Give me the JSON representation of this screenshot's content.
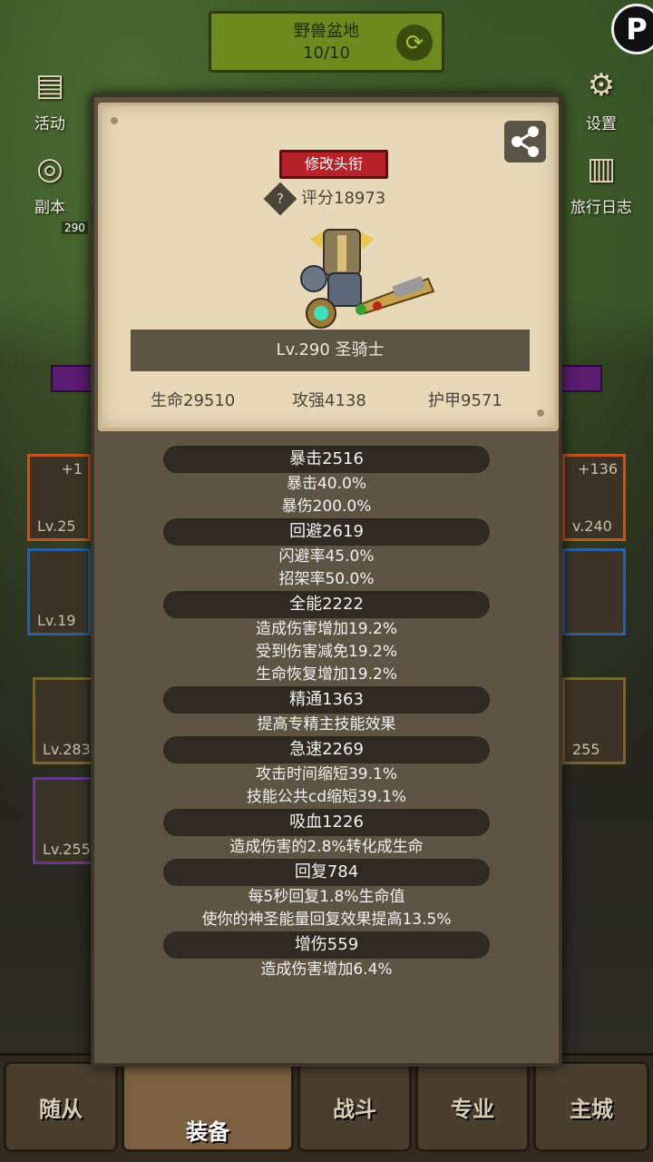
{
  "background": {
    "location_name": "野兽盆地",
    "location_progress": "10/10",
    "left_menu": [
      {
        "label": "活动",
        "icon": "event-scroll-icon"
      },
      {
        "label": "副本",
        "icon": "dungeon-portal-icon"
      }
    ],
    "right_menu": [
      {
        "label": "设置",
        "icon": "gear-icon"
      },
      {
        "label": "旅行日志",
        "icon": "journal-icon"
      }
    ],
    "side_small_level": "290",
    "slots": [
      {
        "plus": "+1",
        "level": "Lv.25"
      },
      {
        "level": "Lv.19"
      },
      {
        "plus": "+136",
        "level": "v.240"
      },
      {
        "level": "Lv.283"
      },
      {
        "level": "Lv.255"
      },
      {
        "level": "255"
      }
    ],
    "nav_tabs": [
      "随从",
      "装备",
      "战斗",
      "专业",
      "主城"
    ]
  },
  "profile": {
    "title_button": "修改头衔",
    "score_label": "评分18973",
    "score_help_glyph": "?",
    "level_class": "Lv.290 圣骑士",
    "stats": {
      "hp": "生命29510",
      "attack": "攻强4138",
      "armor": "护甲9571"
    }
  },
  "attributes": [
    {
      "head": "暴击2516",
      "lines": [
        "暴击40.0%",
        "暴伤200.0%"
      ]
    },
    {
      "head": "回避2619",
      "lines": [
        "闪避率45.0%",
        "招架率50.0%"
      ]
    },
    {
      "head": "全能2222",
      "lines": [
        "造成伤害增加19.2%",
        "受到伤害减免19.2%",
        "生命恢复增加19.2%"
      ]
    },
    {
      "head": "精通1363",
      "lines": [
        "提高专精主技能效果"
      ]
    },
    {
      "head": "急速2269",
      "lines": [
        "攻击时间缩短39.1%",
        "技能公共cd缩短39.1%"
      ]
    },
    {
      "head": "吸血1226",
      "lines": [
        "造成伤害的2.8%转化成生命"
      ]
    },
    {
      "head": "回复784",
      "lines": [
        "每5秒回复1.8%生命值",
        "使你的神圣能量回复效果提高13.5%"
      ]
    },
    {
      "head": "增伤559",
      "lines": [
        "造成伤害增加6.4%"
      ]
    }
  ],
  "colors": {
    "card_bg": "#e7d9b8",
    "dialog_bg": "#5e5443",
    "title_button": "#b8232a",
    "attr_pill": "#2e2921"
  }
}
